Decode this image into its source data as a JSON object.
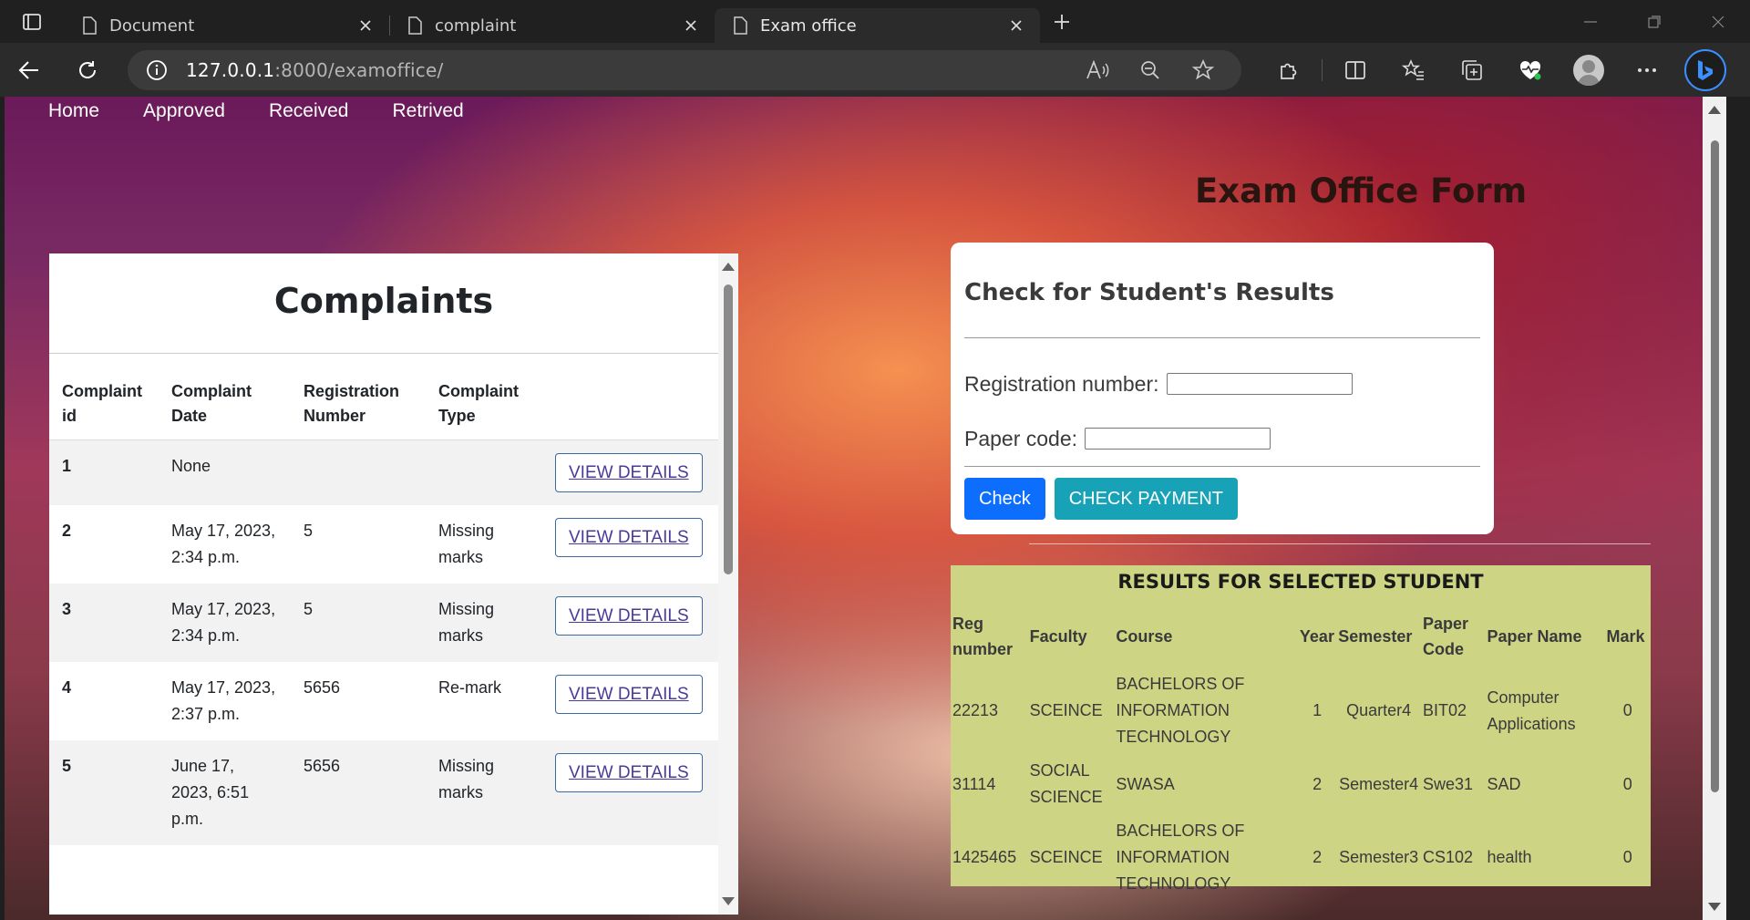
{
  "browser": {
    "tabs": [
      {
        "title": "Document",
        "active": false
      },
      {
        "title": "complaint",
        "active": false
      },
      {
        "title": "Exam office",
        "active": true
      }
    ],
    "url_host": "127.0.0.1",
    "url_rest": ":8000/examoffice/"
  },
  "nav": {
    "items": [
      "Home",
      "Approved",
      "Received",
      "Retrived"
    ]
  },
  "page": {
    "title": "Exam Office Form"
  },
  "complaints": {
    "title": "Complaints",
    "headers": [
      "Complaint id",
      "Complaint Date",
      "Registration Number",
      "Complaint Type"
    ],
    "view_label": "VIEW DETAILS",
    "rows": [
      {
        "id": "1",
        "date": "None",
        "reg": "",
        "type": ""
      },
      {
        "id": "2",
        "date": "May 17, 2023, 2:34 p.m.",
        "reg": "5",
        "type": "Missing marks"
      },
      {
        "id": "3",
        "date": "May 17, 2023, 2:34 p.m.",
        "reg": "5",
        "type": "Missing marks"
      },
      {
        "id": "4",
        "date": "May 17, 2023, 2:37 p.m.",
        "reg": "5656",
        "type": "Re-mark"
      },
      {
        "id": "5",
        "date": "June 17, 2023, 6:51 p.m.",
        "reg": "5656",
        "type": "Missing marks"
      }
    ]
  },
  "check_form": {
    "title": "Check for Student's Results",
    "reg_label": "Registration number:",
    "reg_value": "",
    "paper_label": "Paper code:",
    "paper_value": "",
    "check_label": "Check",
    "payment_label": "CHECK PAYMENT"
  },
  "results": {
    "title": "RESULTS FOR SELECTED STUDENT",
    "headers": [
      "Reg number",
      "Faculty",
      "Course",
      "Year",
      "Semester",
      "Paper Code",
      "Paper Name",
      "Mark"
    ],
    "rows": [
      {
        "reg": "22213",
        "faculty": "SCEINCE",
        "course": "BACHELORS OF INFORMATION TECHNOLOGY",
        "year": "1",
        "semester": "Quarter4",
        "code": "BIT02",
        "name": "Computer Applications",
        "mark": "0"
      },
      {
        "reg": "31114",
        "faculty": "SOCIAL SCIENCE",
        "course": "SWASA",
        "year": "2",
        "semester": "Semester4",
        "code": "Swe31",
        "name": "SAD",
        "mark": "0"
      },
      {
        "reg": "1425465",
        "faculty": "SCEINCE",
        "course": "BACHELORS OF INFORMATION TECHNOLOGY",
        "year": "2",
        "semester": "Semester3",
        "code": "CS102",
        "name": "health",
        "mark": "0"
      }
    ]
  }
}
